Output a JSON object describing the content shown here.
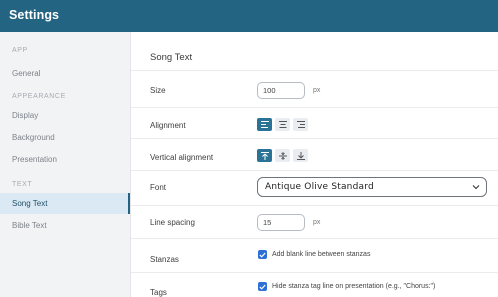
{
  "window": {
    "title": "Settings"
  },
  "sidebar": {
    "sections": [
      {
        "label": "APP",
        "items": [
          {
            "label": "General"
          }
        ]
      },
      {
        "label": "APPEARANCE",
        "items": [
          {
            "label": "Display"
          },
          {
            "label": "Background"
          },
          {
            "label": "Presentation"
          }
        ]
      },
      {
        "label": "TEXT",
        "items": [
          {
            "label": "Song Text",
            "active": true
          },
          {
            "label": "Bible Text"
          }
        ]
      }
    ]
  },
  "content": {
    "heading": "Song Text",
    "size": {
      "label": "Size",
      "value": "100",
      "unit": "px"
    },
    "alignment": {
      "label": "Alignment",
      "selected": "left",
      "options": [
        "left-align-icon",
        "center-align-icon",
        "right-align-icon"
      ]
    },
    "vertical_alignment": {
      "label": "Vertical alignment",
      "selected": "top",
      "options": [
        "align-top-icon",
        "align-middle-icon",
        "align-bottom-icon"
      ]
    },
    "font": {
      "label": "Font",
      "value": "Antique Olive Standard"
    },
    "line_spacing": {
      "label": "Line spacing",
      "value": "15",
      "unit": "px"
    },
    "stanzas": {
      "label": "Stanzas",
      "checkbox_label": "Add blank line between stanzas",
      "checked": true
    },
    "tags": {
      "label": "Tags",
      "checkbox_label": "Hide stanza tag line on presentation (e.g., \"Chorus:\")",
      "checked": true
    }
  },
  "colors": {
    "titlebar": "#246483",
    "accent": "#2b7396",
    "checkbox": "#2d6fd6",
    "active_item_bg": "#dbe9f4"
  }
}
